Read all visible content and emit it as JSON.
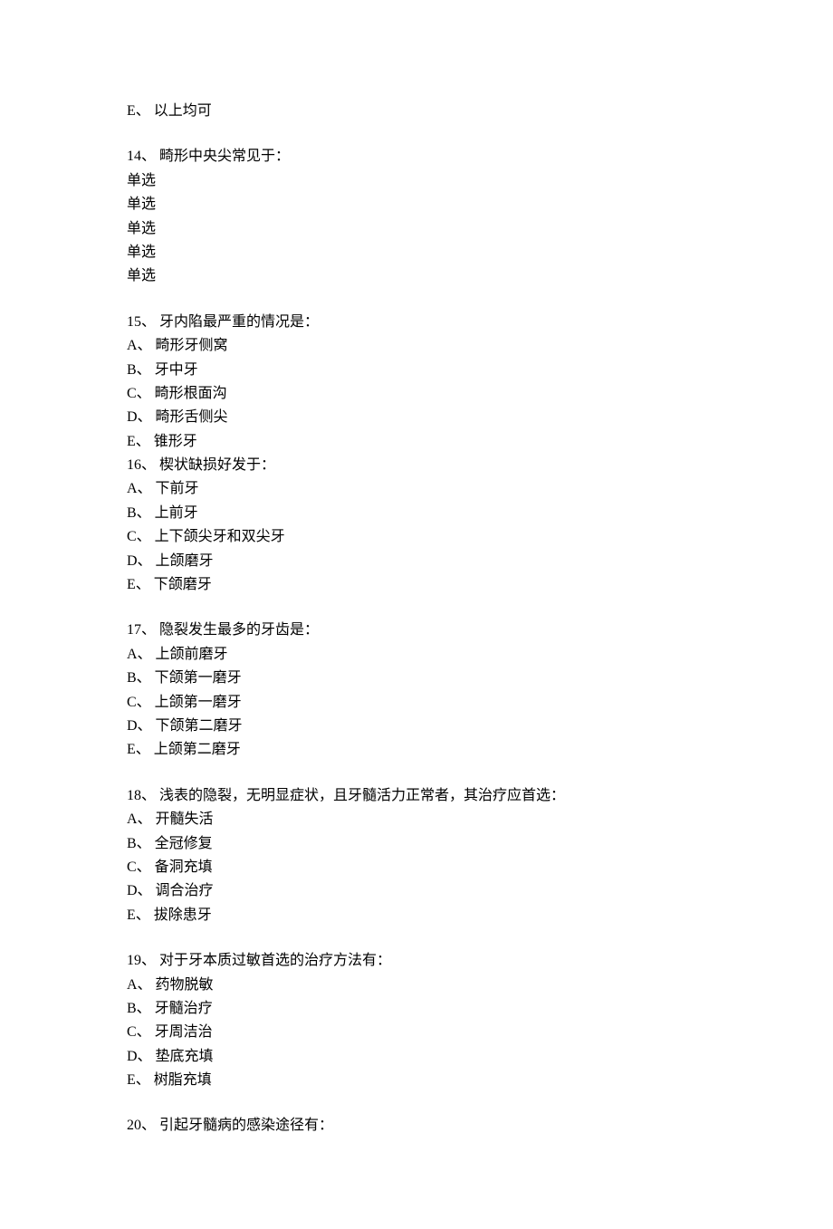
{
  "blocks": [
    {
      "lines": [
        "E、 以上均可"
      ]
    },
    {
      "lines": [
        "14、 畸形中央尖常见于：",
        "单选",
        "单选",
        "单选",
        "单选",
        "单选"
      ]
    },
    {
      "lines": [
        "15、 牙内陷最严重的情况是：",
        "A、 畸形牙侧窝",
        "B、 牙中牙",
        "C、 畸形根面沟",
        "D、 畸形舌侧尖",
        "E、 锥形牙",
        "16、 楔状缺损好发于：",
        "A、 下前牙",
        "B、 上前牙",
        "C、 上下颌尖牙和双尖牙",
        "D、 上颌磨牙",
        "E、 下颌磨牙"
      ]
    },
    {
      "lines": [
        "17、 隐裂发生最多的牙齿是：",
        "A、 上颌前磨牙",
        "B、 下颌第一磨牙",
        "C、 上颌第一磨牙",
        "D、 下颌第二磨牙",
        "E、 上颌第二磨牙"
      ]
    },
    {
      "lines": [
        "18、 浅表的隐裂，无明显症状，且牙髓活力正常者，其治疗应首选：",
        "A、 开髓失活",
        "B、 全冠修复",
        "C、 备洞充填",
        "D、 调合治疗",
        "E、 拔除患牙"
      ]
    },
    {
      "lines": [
        "19、 对于牙本质过敏首选的治疗方法有：",
        "A、 药物脱敏",
        "B、 牙髓治疗",
        "C、 牙周洁治",
        "D、 垫底充填",
        "E、 树脂充填"
      ]
    },
    {
      "lines": [
        "20、 引起牙髓病的感染途径有："
      ]
    }
  ]
}
